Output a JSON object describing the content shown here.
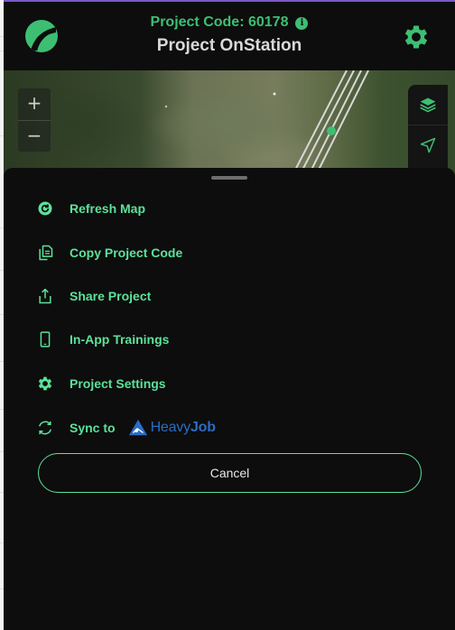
{
  "header": {
    "project_code": "Project Code: 60178",
    "project_name": "Project OnStation",
    "info_icon_glyph": "i",
    "logo_icon": "road-logo-icon",
    "settings_icon": "gear-icon"
  },
  "map": {
    "zoom_in": "+",
    "zoom_out": "−",
    "tools": [
      "layers-icon",
      "navigation-arrow-icon"
    ]
  },
  "menu": {
    "items": [
      {
        "label": "Refresh Map",
        "icon": "refresh-icon"
      },
      {
        "label": "Copy Project Code",
        "icon": "copy-icon"
      },
      {
        "label": "Share Project",
        "icon": "share-icon"
      },
      {
        "label": "In-App Trainings",
        "icon": "mobile-phone-icon"
      },
      {
        "label": "Project Settings",
        "icon": "gear-icon"
      },
      {
        "label": "Sync to",
        "icon": "sync-icon"
      }
    ],
    "heavyjob": {
      "part1": "Heavy",
      "part2": "Job",
      "icon": "heavyjob-logo-icon"
    },
    "cancel_label": "Cancel"
  },
  "colors": {
    "accent": "#3dbf73",
    "menu_text": "#5ce29a",
    "background": "#0d0d0d",
    "heavyjob_blue": "#2b6cc4"
  }
}
